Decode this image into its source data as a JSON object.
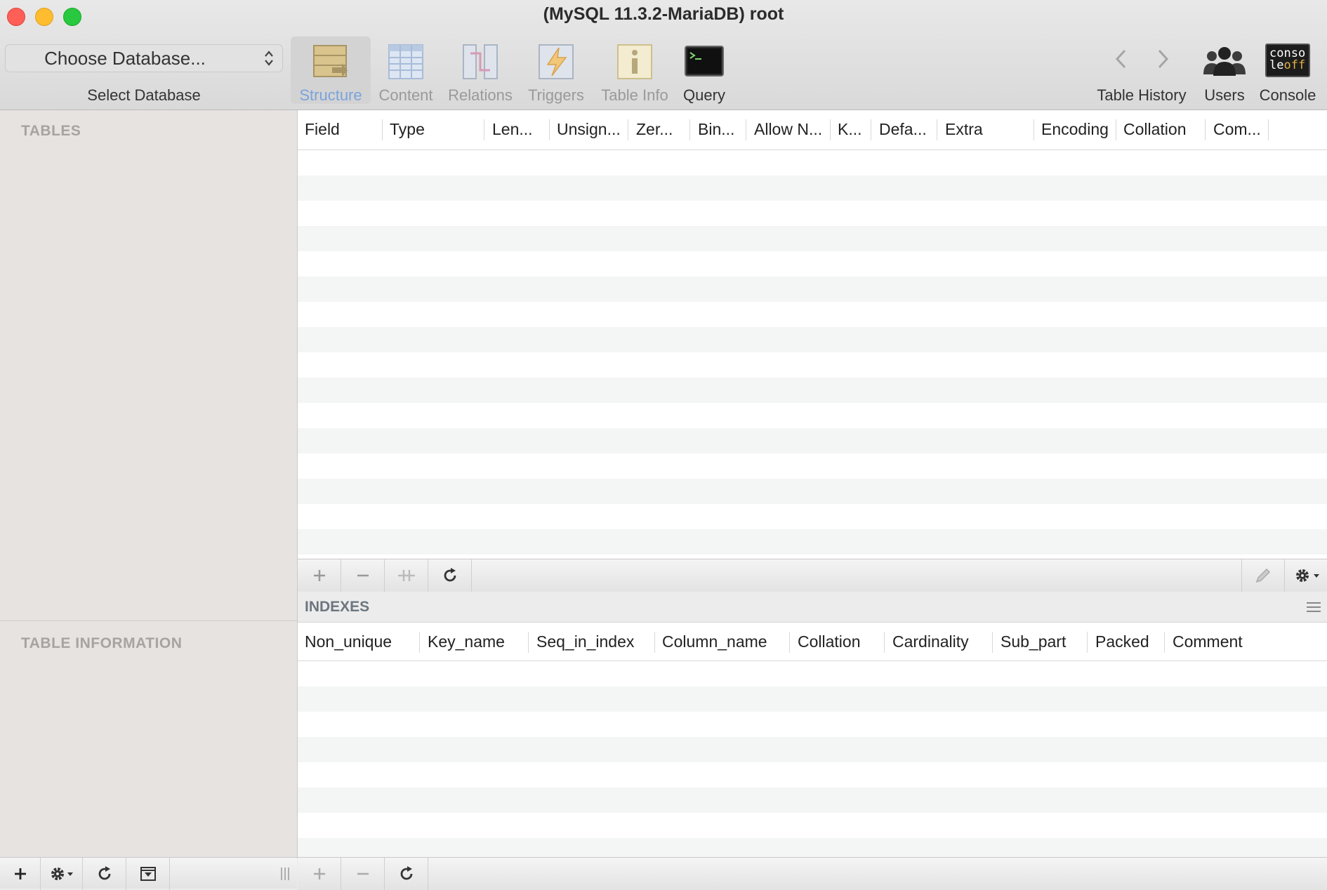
{
  "window": {
    "title": "(MySQL 11.3.2-MariaDB) root",
    "traffic_lights": {
      "close": "#fe5f57",
      "minimize": "#febc2e",
      "zoom": "#28c840"
    }
  },
  "toolbar": {
    "database_selector": {
      "value": "Choose Database...",
      "caption": "Select Database"
    },
    "tabs": [
      {
        "label": "Structure",
        "icon": "structure-icon",
        "active": true
      },
      {
        "label": "Content",
        "icon": "content-table-icon"
      },
      {
        "label": "Relations",
        "icon": "relations-icon"
      },
      {
        "label": "Triggers",
        "icon": "triggers-icon"
      },
      {
        "label": "Table Info",
        "icon": "table-info-icon"
      },
      {
        "label": "Query",
        "icon": "terminal-icon"
      }
    ],
    "right": [
      {
        "label": "Table History",
        "icon": "history-arrows-icon"
      },
      {
        "label": "Users",
        "icon": "users-icon"
      },
      {
        "label": "Console",
        "icon": "console-icon",
        "icon_text": [
          "conso",
          "le",
          "off"
        ]
      }
    ]
  },
  "sidebar": {
    "tables_heading": "TABLES",
    "table_info_heading": "TABLE INFORMATION"
  },
  "structure": {
    "columns": [
      "Field",
      "Type",
      "Len...",
      "Unsign...",
      "Zer...",
      "Bin...",
      "Allow N...",
      "K...",
      "Defa...",
      "Extra",
      "Encoding",
      "Collation",
      "Com..."
    ]
  },
  "indexes": {
    "heading": "INDEXES",
    "columns": [
      "Non_unique",
      "Key_name",
      "Seq_in_index",
      "Column_name",
      "Collation",
      "Cardinality",
      "Sub_part",
      "Packed",
      "Comment"
    ]
  },
  "colors": {
    "accent": "#7aa3dc",
    "sidebar_bg": "#e7e3e1",
    "heading_gray": "#a6a3a1"
  }
}
